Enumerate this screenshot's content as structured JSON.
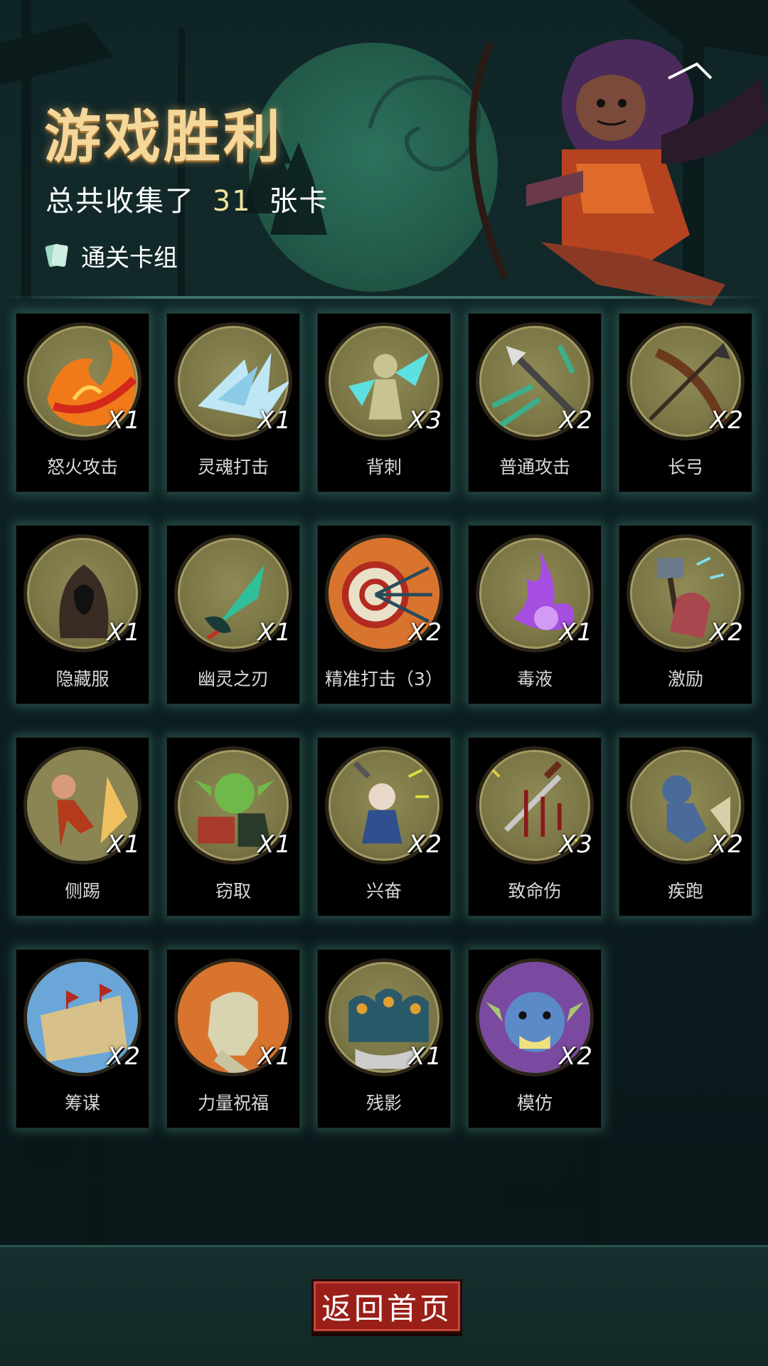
{
  "header": {
    "title": "游戏胜利",
    "summary_prefix": "总共收集了",
    "summary_count": "31",
    "summary_suffix": "张卡",
    "deck_label": "通关卡组"
  },
  "cards": [
    {
      "name": "怒火攻击",
      "mult": "X1",
      "icon": "fire-slash-icon"
    },
    {
      "name": "灵魂打击",
      "mult": "X1",
      "icon": "ice-crystal-icon"
    },
    {
      "name": "背刺",
      "mult": "X3",
      "icon": "backstab-icon"
    },
    {
      "name": "普通攻击",
      "mult": "X2",
      "icon": "arrow-strike-icon"
    },
    {
      "name": "长弓",
      "mult": "X2",
      "icon": "longbow-icon"
    },
    {
      "name": "隐藏服",
      "mult": "X1",
      "icon": "hooded-cloak-icon"
    },
    {
      "name": "幽灵之刃",
      "mult": "X1",
      "icon": "ghost-blade-icon"
    },
    {
      "name": "精准打击（3）",
      "mult": "X2",
      "icon": "target-icon"
    },
    {
      "name": "毒液",
      "mult": "X1",
      "icon": "poison-splash-icon"
    },
    {
      "name": "激励",
      "mult": "X2",
      "icon": "hammer-warrior-icon"
    },
    {
      "name": "侧踢",
      "mult": "X1",
      "icon": "side-kick-icon"
    },
    {
      "name": "窃取",
      "mult": "X1",
      "icon": "goblin-thief-icon"
    },
    {
      "name": "兴奋",
      "mult": "X2",
      "icon": "dwarf-icon"
    },
    {
      "name": "致命伤",
      "mult": "X3",
      "icon": "bleeding-knife-icon"
    },
    {
      "name": "疾跑",
      "mult": "X2",
      "icon": "sprinting-wolf-icon"
    },
    {
      "name": "筹谋",
      "mult": "X2",
      "icon": "strategy-map-icon"
    },
    {
      "name": "力量祝福",
      "mult": "X1",
      "icon": "fist-icon"
    },
    {
      "name": "残影",
      "mult": "X1",
      "icon": "shadow-clones-icon"
    },
    {
      "name": "模仿",
      "mult": "X2",
      "icon": "troll-face-icon"
    }
  ],
  "footer": {
    "home_button": "返回首页"
  },
  "colors": {
    "title": "#f6d79a",
    "count": "#f3e39a",
    "button": "#9a1f19",
    "medallion": "#8f8a55"
  }
}
